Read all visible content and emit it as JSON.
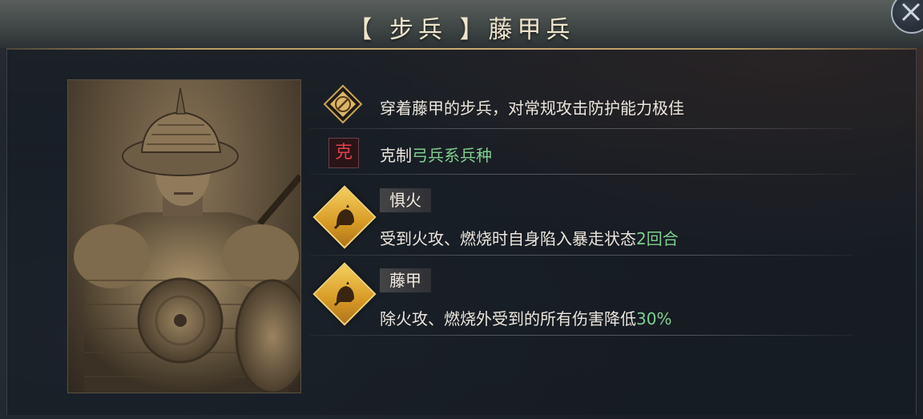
{
  "header": {
    "title": "【 步兵 】藤甲兵"
  },
  "unit": {
    "description": "穿着藤甲的步兵，对常规攻击防护能力极佳",
    "counter_prefix": "克制",
    "counter_target": "弓兵系兵种",
    "counter_icon_char": "克"
  },
  "skills": [
    {
      "name": "惧火",
      "desc_main": "受到火攻、燃烧时自身陷入暴走状态",
      "desc_value": "2回合",
      "icon": "helmet-fire-icon"
    },
    {
      "name": "藤甲",
      "desc_main": "除火攻、燃烧外受到的所有伤害降低",
      "desc_value": "30%",
      "icon": "helmet-armor-icon"
    }
  ],
  "colors": {
    "accent_gold": "#d79a24",
    "highlight_green": "#7fcf8f",
    "counter_red": "#e0404a"
  }
}
